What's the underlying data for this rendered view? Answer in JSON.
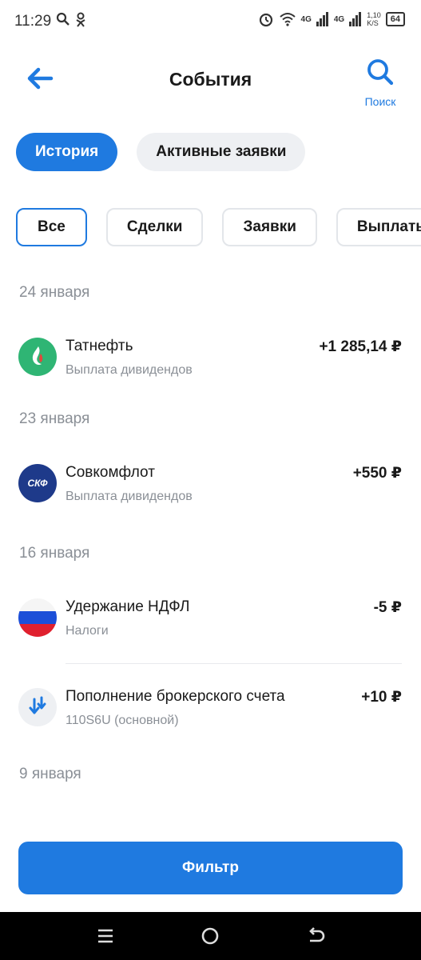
{
  "status_bar": {
    "time": "11:29",
    "network_1": "4G",
    "network_2": "4G",
    "speed_value": "1,10",
    "speed_unit": "K/S",
    "battery": "64"
  },
  "header": {
    "title": "События",
    "search_label": "Поиск"
  },
  "main_tabs": [
    {
      "label": "История",
      "active": true
    },
    {
      "label": "Активные заявки",
      "active": false
    }
  ],
  "filter_chips": [
    {
      "label": "Все",
      "active": true
    },
    {
      "label": "Сделки",
      "active": false
    },
    {
      "label": "Заявки",
      "active": false
    },
    {
      "label": "Выплаты",
      "active": false
    }
  ],
  "groups": [
    {
      "date": "24 января",
      "events": [
        {
          "icon": "tatneft-logo",
          "name": "Татнефть",
          "subtitle": "Выплата дивидендов",
          "amount": "+1 285,14 ₽"
        }
      ]
    },
    {
      "date": "23 января",
      "events": [
        {
          "icon": "sovcomflot-logo",
          "logo_text": "СКФ",
          "name": "Совкомфлот",
          "subtitle": "Выплата дивидендов",
          "amount": "+550 ₽"
        }
      ]
    },
    {
      "date": "16 января",
      "events": [
        {
          "icon": "russian-flag-icon",
          "name": "Удержание НДФЛ",
          "subtitle": "Налоги",
          "amount": "-5 ₽"
        },
        {
          "icon": "deposit-arrows-icon",
          "name": "Пополнение брокерского счета",
          "subtitle": "110S6U (основной)",
          "amount": "+10 ₽"
        }
      ]
    },
    {
      "date": "9 января",
      "events": []
    }
  ],
  "filter_button": "Фильтр",
  "colors": {
    "accent": "#1f7ae0",
    "tatneft_green": "#2fb574",
    "sovcomflot_navy": "#1e3a8a"
  }
}
